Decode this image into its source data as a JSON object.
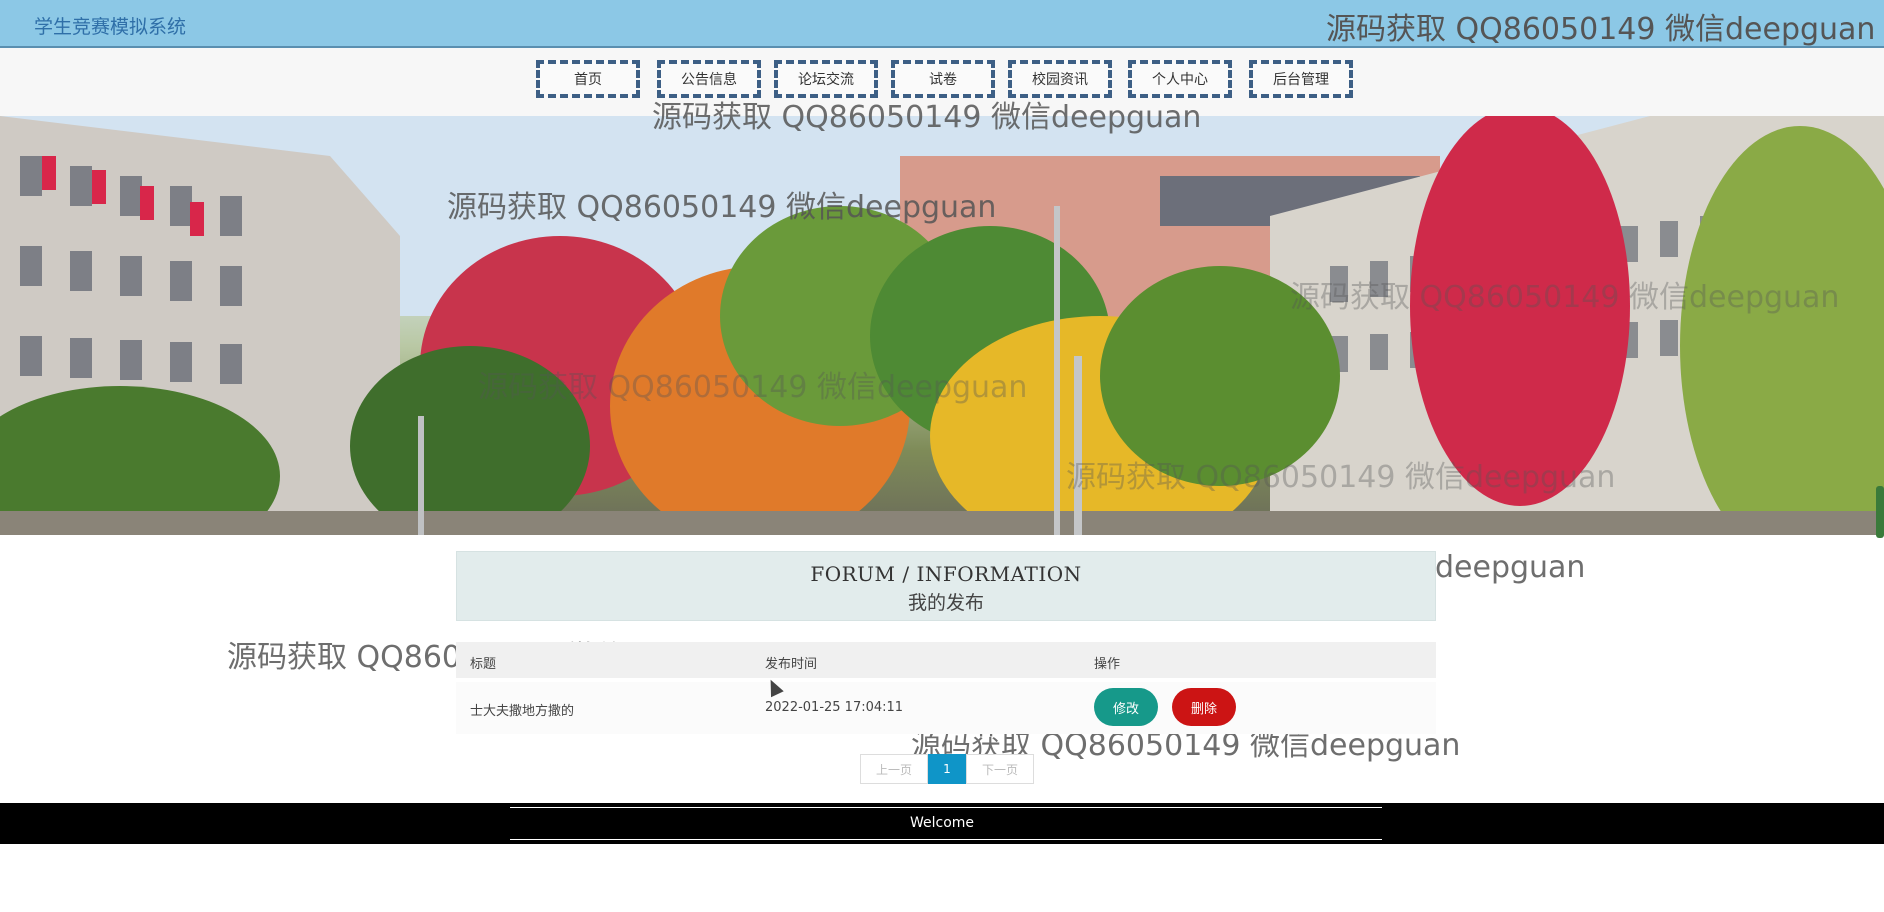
{
  "header": {
    "site_title": "学生竞赛模拟系统",
    "watermark": "源码获取 QQ86050149 微信deepguan"
  },
  "nav": {
    "items": [
      "首页",
      "公告信息",
      "论坛交流",
      "试卷",
      "校园资讯",
      "个人中心",
      "后台管理"
    ]
  },
  "banner": {
    "slides_total": 3,
    "active_slide": 1
  },
  "section": {
    "title_en": "FORUM / INFORMATION",
    "title_zh": "我的发布"
  },
  "table": {
    "columns": [
      "标题",
      "发布时间",
      "操作"
    ],
    "rows": [
      {
        "title": "士大夫撒地方撒的",
        "time": "2022-01-25 17:04:11",
        "edit_label": "修改",
        "delete_label": "删除"
      }
    ]
  },
  "pager": {
    "prev": "上一页",
    "current": "1",
    "next": "下一页"
  },
  "footer": {
    "text": "Welcome"
  },
  "colors": {
    "topbar": "#8cc8e6",
    "edit_button": "#16998a",
    "delete_button": "#cc1414",
    "pager_active": "#0f95c8",
    "footer": "#000000"
  }
}
